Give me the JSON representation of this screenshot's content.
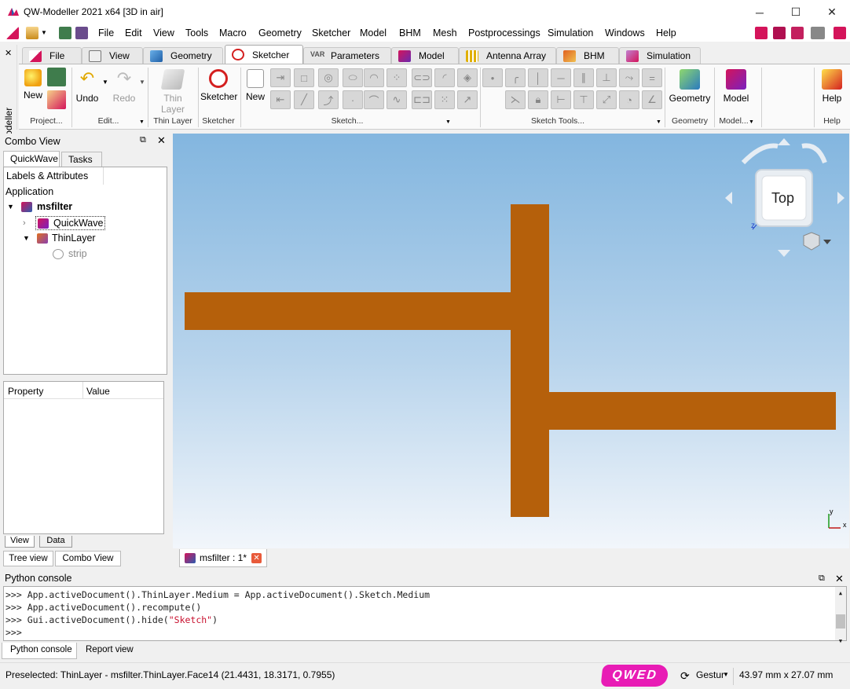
{
  "window": {
    "title": "QW-Modeller 2021 x64 [3D in air]",
    "minimize": "─",
    "maximize": "☐",
    "close": "✕"
  },
  "menu": [
    "File",
    "Edit",
    "View",
    "Tools",
    "Macro",
    "Geometry",
    "Sketcher",
    "Model",
    "BHM",
    "Mesh",
    "Postprocessings",
    "Simulation",
    "Windows",
    "Help"
  ],
  "workbench_tabs": [
    "File",
    "View",
    "Geometry",
    "Sketcher",
    "Parameters",
    "Model",
    "Antenna Array",
    "BHM",
    "Simulation"
  ],
  "active_workbench_tab": "Sketcher",
  "parameters_icon_text": "VAR",
  "left_strip_label": "QW-Modeller",
  "left_strip_close": "✕",
  "ribbon": {
    "new_label": "New",
    "undo_label": "Undo",
    "redo_label": "Redo",
    "thin_layer_label": "Thin Layer",
    "sketcher_label": "Sketcher",
    "sketch_new_label": "New",
    "geometry_label": "Geometry",
    "model_label": "Model",
    "help_label": "Help",
    "groups": {
      "project": "Project...",
      "edit": "Edit...",
      "thin_layer": "Thin Layer",
      "sketcher": "Sketcher",
      "sketch": "Sketch...",
      "sketch_tools": "Sketch Tools...",
      "geometry": "Geometry",
      "model": "Model...",
      "help": "Help"
    }
  },
  "combo_view": {
    "title": "Combo View",
    "tabs": [
      "QuickWave",
      "Tasks"
    ],
    "labels_header": "Labels & Attributes",
    "application_label": "Application",
    "tree": {
      "root": "msfilter",
      "child1": "QuickWave",
      "child2": "ThinLayer",
      "grandchild": "strip"
    },
    "property_header": "Property",
    "value_header": "Value",
    "bottom_tabs": [
      "View",
      "Data"
    ],
    "view_tabs": [
      "Tree view",
      "Combo View"
    ]
  },
  "navcube": {
    "face_label": "Top",
    "axis_label": "z"
  },
  "axes": {
    "x": "x",
    "y": "y"
  },
  "document_tab": "msfilter : 1*",
  "python_console": {
    "title": "Python console",
    "prompt": ">>>",
    "lines": [
      ">>> App.activeDocument().ThinLayer.Medium = App.activeDocument().Sketch.Medium",
      ">>> App.activeDocument().recompute()",
      ">>> Gui.activeDocument().hide("
    ],
    "line3_string": "\"Sketch\"",
    "line3_end": ")",
    "empty_prompt": ">>>"
  },
  "bottom_tabs": [
    "Python console",
    "Report view"
  ],
  "status": {
    "preselected": "Preselected: ThinLayer - msfilter.ThinLayer.Face14 (21.4431, 18.3171, 0.7955)",
    "nav_style": "Gestur",
    "dimensions": "43.97 mm x 27.07 mm",
    "logo": "QWED"
  },
  "colors": {
    "strip": "#b5600b",
    "sky_top": "#83b6df",
    "sky_bottom": "#f2f6fb",
    "accent": "#d4145a"
  }
}
